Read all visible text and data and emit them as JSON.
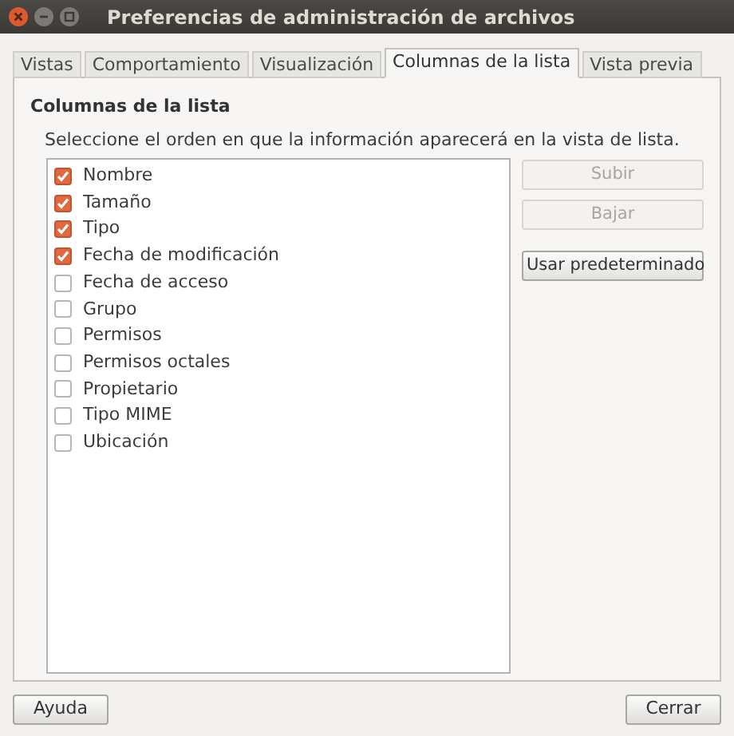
{
  "window": {
    "title": "Preferencias de administración de archivos"
  },
  "tabs": [
    {
      "label": "Vistas",
      "selected": false
    },
    {
      "label": "Comportamiento",
      "selected": false
    },
    {
      "label": "Visualización",
      "selected": false
    },
    {
      "label": "Columnas de la lista",
      "selected": true
    },
    {
      "label": "Vista previa",
      "selected": false
    }
  ],
  "section": {
    "heading": "Columnas de la lista",
    "description": "Seleccione el orden en que la información aparecerá en la vista de lista."
  },
  "columns": [
    {
      "label": "Nombre",
      "checked": true
    },
    {
      "label": "Tamaño",
      "checked": true
    },
    {
      "label": "Tipo",
      "checked": true
    },
    {
      "label": "Fecha de modificación",
      "checked": true
    },
    {
      "label": "Fecha de acceso",
      "checked": false
    },
    {
      "label": "Grupo",
      "checked": false
    },
    {
      "label": "Permisos",
      "checked": false
    },
    {
      "label": "Permisos octales",
      "checked": false
    },
    {
      "label": "Propietario",
      "checked": false
    },
    {
      "label": "Tipo MIME",
      "checked": false
    },
    {
      "label": "Ubicación",
      "checked": false
    }
  ],
  "side_buttons": [
    {
      "label": "Subir",
      "disabled": true
    },
    {
      "label": "Bajar",
      "disabled": true
    },
    {
      "label": "Usar predeterminado",
      "disabled": false
    }
  ],
  "footer_buttons": [
    "Ayuda",
    "Cerrar"
  ]
}
